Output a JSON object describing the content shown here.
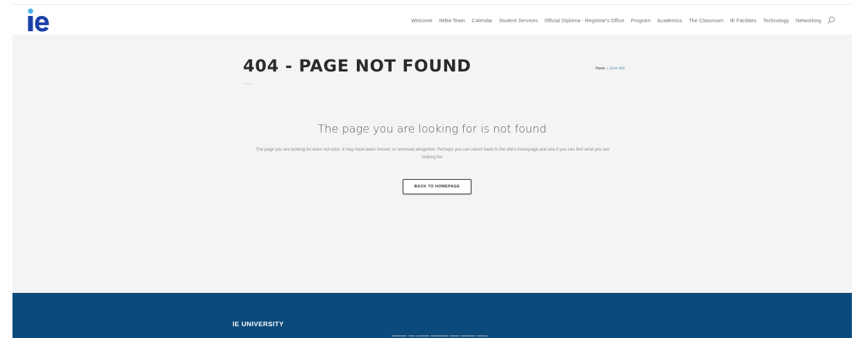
{
  "header": {
    "logo_alt": "ie",
    "nav": [
      {
        "label": "Welcome"
      },
      {
        "label": "IMBA Team"
      },
      {
        "label": "Calendar"
      },
      {
        "label": "Student Services"
      },
      {
        "label": "Official Diploma - Registrar's Office"
      },
      {
        "label": "Program"
      },
      {
        "label": "Academics"
      },
      {
        "label": "The Classroom"
      },
      {
        "label": "IE Facilities"
      },
      {
        "label": "Technology"
      },
      {
        "label": "Networking"
      }
    ],
    "search_icon": "search-icon"
  },
  "main": {
    "title": "404 - PAGE NOT FOUND",
    "breadcrumb": {
      "home": "Home",
      "separator": "»",
      "current": "Error 404"
    },
    "heading": "The page you are looking for is not found",
    "description": "The page you are looking for does not exist. It may have been moved, or removed altogether. Perhaps you can return back to the site's homepage and see if you can find what you are looking for.",
    "button_label": "BACK TO HOMEPAGE"
  },
  "footer": {
    "title": "IE UNIVERSITY"
  },
  "colors": {
    "logo_blue": "#1c3fa8",
    "logo_dot": "#4fb3e8",
    "content_bg": "#f4f4f4",
    "footer_bg": "#0b4a7b",
    "breadcrumb_link": "#4a90b8"
  }
}
